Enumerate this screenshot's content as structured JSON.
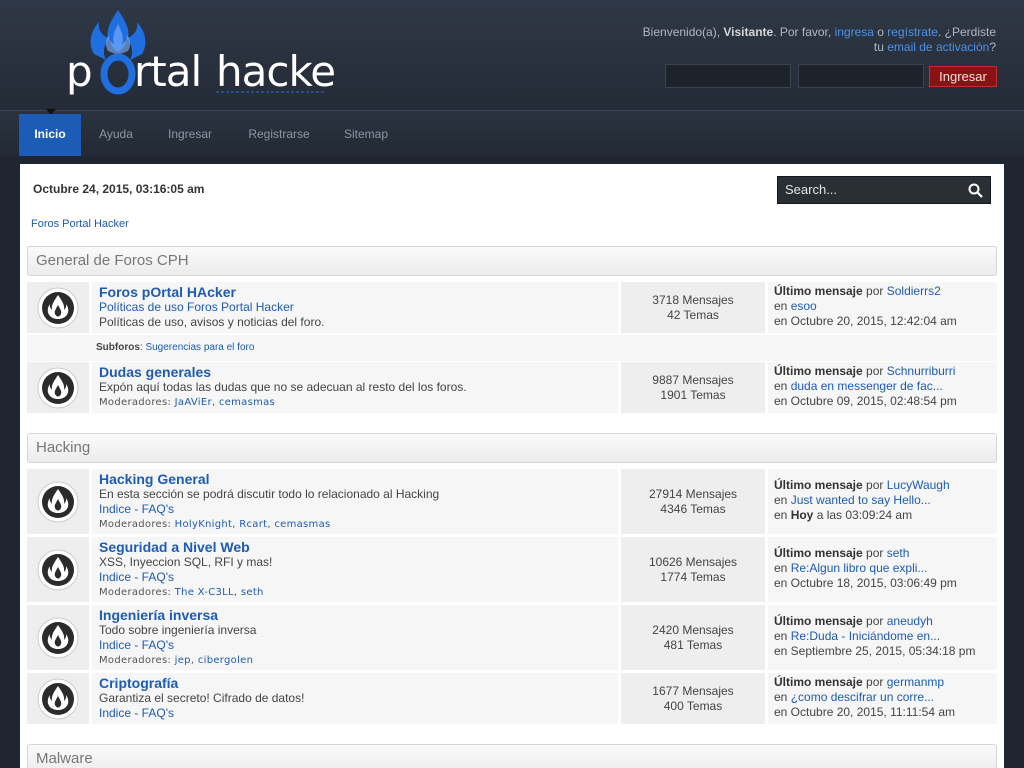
{
  "header": {
    "logo_text": "pOrtal hacker",
    "welcome_prefix": "Bienvenido(a), ",
    "visitor": "Visitante",
    "welcome_mid": ". Por favor, ",
    "login_link": "ingresa",
    "or": " o ",
    "register_link": "regístrate",
    "welcome_tail": ". ¿Perdiste",
    "line2_prefix": "tu ",
    "activation_link": "email de activación",
    "line2_tail": "?",
    "login_button": "Ingresar"
  },
  "nav": {
    "items": [
      {
        "label": "Inicio",
        "active": true
      },
      {
        "label": "Ayuda"
      },
      {
        "label": "Ingresar"
      },
      {
        "label": "Registrarse"
      },
      {
        "label": "Sitemap"
      }
    ]
  },
  "main": {
    "date": "Octubre 24, 2015, 03:16:05 am",
    "search_placeholder": "Search...",
    "breadcrumb": "Foros Portal Hacker"
  },
  "categories": [
    {
      "title": "General de Foros CPH",
      "boards": [
        {
          "name": "Foros pOrtal HAcker",
          "link": "Políticas de uso Foros Portal Hacker",
          "desc": "Políticas de uso, avisos y noticias del foro.",
          "posts": "3718 Mensajes",
          "topics": "42 Temas",
          "last_label": "Último mensaje",
          "by": " por ",
          "last_user": "Soldierrs2",
          "in": "en ",
          "last_topic": "esoo",
          "last_date": "en Octubre 20, 2015, 12:42:04 am",
          "subforos_label": "Subforos",
          "subforos": "Sugerencias para el foro"
        },
        {
          "name": "Dudas generales",
          "desc": "Expón aquí todas las dudas que no se adecuan al resto del los foros.",
          "mods_label": "Moderadores: ",
          "mods": [
            "JaAViEr",
            "cemasmas"
          ],
          "posts": "9887 Mensajes",
          "topics": "1901 Temas",
          "last_label": "Último mensaje",
          "by": " por ",
          "last_user": "Schnurriburri",
          "in": "en ",
          "last_topic": "duda en messenger de fac...",
          "last_date": "en Octubre 09, 2015, 02:48:54 pm"
        }
      ]
    },
    {
      "title": "Hacking",
      "boards": [
        {
          "name": "Hacking General",
          "desc": "En esta sección se podrá discutir todo lo relacionado al Hacking",
          "link": "Indice - FAQ's",
          "mods_label": "Moderadores: ",
          "mods": [
            "HolyKnight",
            "Rcart",
            "cemasmas"
          ],
          "posts": "27914 Mensajes",
          "topics": "4346 Temas",
          "last_label": "Último mensaje",
          "by": " por ",
          "last_user": "LucyWaugh",
          "in": "en ",
          "last_topic": "Just wanted to say Hello...",
          "last_date_prefix": "en ",
          "last_date_bold": "Hoy",
          "last_date_tail": " a las 03:09:24 am"
        },
        {
          "name": "Seguridad a Nivel Web",
          "desc": "XSS, Inyeccion SQL, RFI y mas!",
          "link": "Indice - FAQ's",
          "mods_label": "Moderadores: ",
          "mods": [
            "The X-C3LL",
            "seth"
          ],
          "posts": "10626 Mensajes",
          "topics": "1774 Temas",
          "last_label": "Último mensaje",
          "by": " por ",
          "last_user": "seth",
          "in": "en ",
          "last_topic": "Re:Algun libro que expli...",
          "last_date": "en Octubre 18, 2015, 03:06:49 pm"
        },
        {
          "name": "Ingeniería inversa",
          "desc": "Todo sobre ingeniería inversa",
          "link": "Indice - FAQ's",
          "mods_label": "Moderadores: ",
          "mods": [
            "jep",
            "cibergolen"
          ],
          "posts": "2420 Mensajes",
          "topics": "481 Temas",
          "last_label": "Último mensaje",
          "by": " por ",
          "last_user": "aneudyh",
          "in": "en ",
          "last_topic": "Re:Duda - Iniciándome en...",
          "last_date": "en Septiembre 25, 2015, 05:34:18 pm"
        },
        {
          "name": "Criptografía",
          "desc": "Garantiza el secreto! Cifrado de datos!",
          "link": "Indice - FAQ's",
          "posts": "1677 Mensajes",
          "topics": "400 Temas",
          "last_label": "Último mensaje",
          "by": " por ",
          "last_user": "germanmp",
          "in": "en ",
          "last_topic": "¿como descifrar un corre...",
          "last_date": "en Octubre 20, 2015, 11:11:54 am"
        }
      ]
    },
    {
      "title": "Malware"
    }
  ],
  "colors": {
    "accent": "#1d5cb6",
    "link": "#1d5bb5",
    "login_button": "#8a1212",
    "header_bg": "#2f3846",
    "logo_flame": "#1f6fe0"
  }
}
